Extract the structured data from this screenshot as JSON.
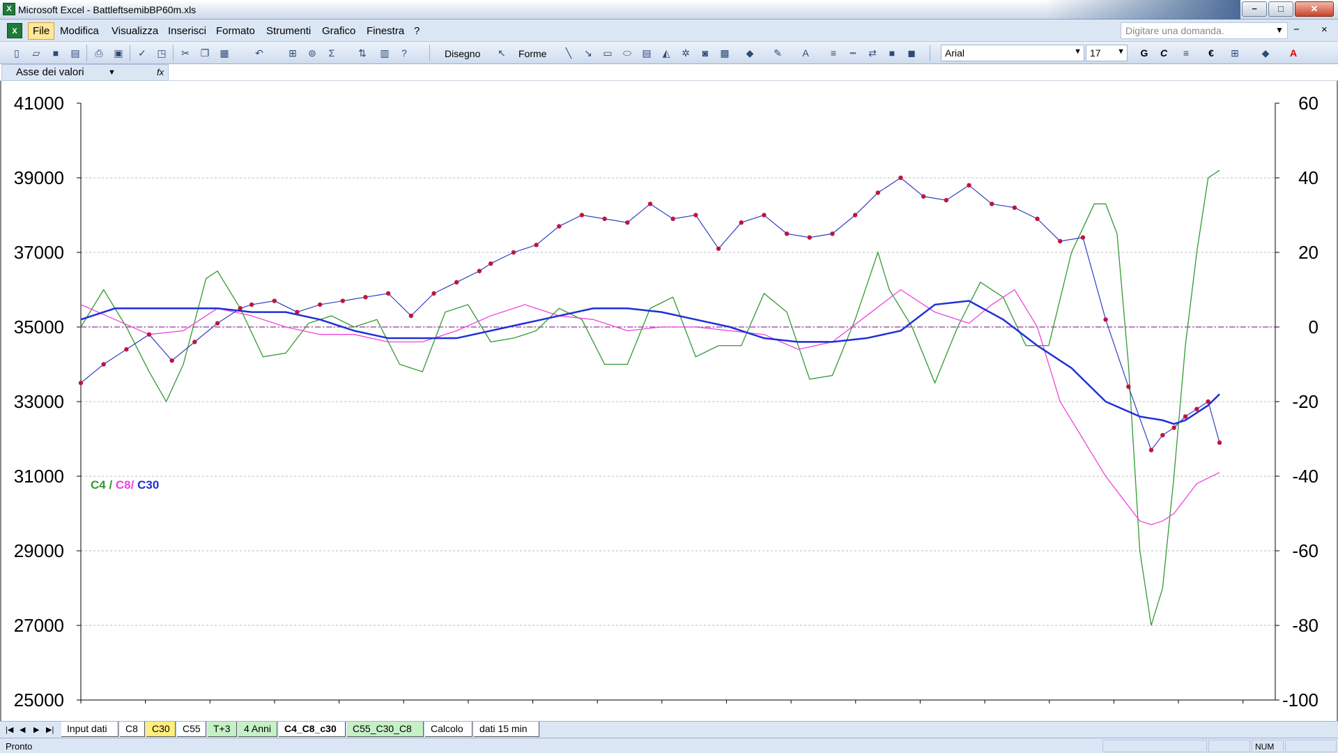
{
  "window": {
    "title": "Microsoft Excel - BattleftsemibBP60m.xls",
    "min_label": "−",
    "max_label": "□",
    "close_label": "✕"
  },
  "menu": {
    "items": [
      "File",
      "Modifica",
      "Visualizza",
      "Inserisci",
      "Formato",
      "Strumenti",
      "Grafico",
      "Finestra",
      "?"
    ],
    "help_placeholder": "Digitare una domanda.",
    "right_icons": [
      "−",
      "×"
    ]
  },
  "toolbar": {
    "draw_label": "Disegno",
    "shapes_label": "Forme",
    "font_name": "Arial",
    "font_size": "17",
    "bold_label": "G",
    "italic_label": "C",
    "euro_label": "€",
    "font_color_label": "A"
  },
  "namebox": {
    "value": "Asse dei valori",
    "fx_label": "fx"
  },
  "colors": {
    "c4": "#339933",
    "c8": "#ee44dd",
    "c30": "#1f2fd8",
    "price_line": "#3040c0",
    "price_marker": "#c0143c",
    "zero_line": "#993399"
  },
  "chart_data": {
    "type": "line",
    "legend_label": {
      "c4": "C4",
      "sep1": " / ",
      "c8": "C8/",
      "sep2": " ",
      "c30": "C30"
    },
    "y_left": {
      "min": 25000,
      "max": 41000,
      "step": 2000,
      "ticks": [
        "41000",
        "39000",
        "37000",
        "35000",
        "33000",
        "31000",
        "29000",
        "27000",
        "25000"
      ]
    },
    "y_right": {
      "min": -100,
      "max": 60,
      "step": 20,
      "ticks": [
        "60",
        "40",
        "20",
        "0",
        "-20",
        "-40",
        "-60",
        "-80",
        "-100"
      ]
    },
    "x_range": [
      0,
      100
    ],
    "grid": true,
    "zero_reference": 0,
    "price": {
      "name": "price",
      "x": [
        0,
        2,
        4,
        6,
        8,
        10,
        12,
        14,
        15,
        17,
        19,
        21,
        23,
        25,
        27,
        29,
        31,
        33,
        35,
        36,
        38,
        40,
        42,
        44,
        46,
        48,
        50,
        52,
        54,
        56,
        58,
        60,
        62,
        64,
        66,
        68,
        70,
        72,
        74,
        76,
        78,
        80,
        82,
        84,
        86,
        88,
        90,
        92,
        94,
        95,
        96,
        97,
        98,
        99,
        100
      ],
      "y": [
        33500,
        34000,
        34400,
        34800,
        34100,
        34600,
        35100,
        35500,
        35600,
        35700,
        35400,
        35600,
        35700,
        35800,
        35900,
        35300,
        35900,
        36200,
        36500,
        36700,
        37000,
        37200,
        37700,
        38000,
        37900,
        37800,
        38300,
        37900,
        38000,
        37100,
        37800,
        38000,
        37500,
        37400,
        37500,
        38000,
        38600,
        39000,
        38500,
        38400,
        38800,
        38300,
        38200,
        37900,
        37300,
        37400,
        35200,
        33400,
        31700,
        32100,
        32300,
        32600,
        32800,
        33000,
        31900
      ]
    },
    "series": [
      {
        "name": "C4",
        "x": [
          0,
          2,
          4,
          6,
          7.5,
          9,
          11,
          12,
          14,
          16,
          18,
          20,
          22,
          24,
          26,
          28,
          30,
          32,
          34,
          36,
          38,
          40,
          42,
          44,
          46,
          48,
          50,
          52,
          54,
          56,
          58,
          60,
          62,
          64,
          66,
          68,
          70,
          71,
          73,
          75,
          77,
          79,
          81,
          83,
          85,
          87,
          89,
          90,
          91,
          92,
          93,
          94,
          95,
          96,
          97,
          98,
          99,
          100
        ],
        "y": [
          0,
          10,
          0,
          -12,
          -20,
          -10,
          13,
          15,
          5,
          -8,
          -7,
          1,
          3,
          0,
          2,
          -10,
          -12,
          4,
          6,
          -4,
          -3,
          -1,
          5,
          2,
          -10,
          -10,
          5,
          8,
          -8,
          -5,
          -5,
          9,
          4,
          -14,
          -13,
          2,
          20,
          10,
          0,
          -15,
          0,
          12,
          8,
          -5,
          -5,
          20,
          33,
          33,
          25,
          -10,
          -60,
          -80,
          -70,
          -40,
          -5,
          20,
          40,
          42
        ]
      },
      {
        "name": "C8",
        "x": [
          0,
          3,
          6,
          9,
          12,
          15,
          18,
          21,
          24,
          27,
          30,
          33,
          36,
          39,
          42,
          45,
          48,
          51,
          54,
          57,
          60,
          63,
          66,
          69,
          72,
          75,
          78,
          80,
          82,
          84,
          86,
          88,
          90,
          92,
          93,
          94,
          95,
          96,
          97,
          98,
          100
        ],
        "y": [
          6,
          2,
          -2,
          -1,
          5,
          3,
          0,
          -2,
          -2,
          -4,
          -4,
          -1,
          3,
          6,
          3,
          2,
          -1,
          0,
          0,
          -1,
          -2,
          -6,
          -4,
          3,
          10,
          4,
          1,
          6,
          10,
          0,
          -20,
          -30,
          -40,
          -48,
          -52,
          -53,
          -52,
          -50,
          -46,
          -42,
          -39
        ]
      },
      {
        "name": "C30",
        "x": [
          0,
          3,
          6,
          9,
          12,
          15,
          18,
          21,
          24,
          27,
          30,
          33,
          36,
          39,
          42,
          45,
          48,
          51,
          54,
          57,
          60,
          63,
          66,
          69,
          72,
          75,
          78,
          81,
          84,
          87,
          90,
          93,
          95,
          96,
          97,
          98,
          99,
          100
        ],
        "y": [
          2,
          5,
          5,
          5,
          5,
          4,
          4,
          2,
          -1,
          -3,
          -3,
          -3,
          -1,
          1,
          3,
          5,
          5,
          4,
          2,
          0,
          -3,
          -4,
          -4,
          -3,
          -1,
          6,
          7,
          2,
          -5,
          -11,
          -20,
          -24,
          -25,
          -26,
          -25,
          -23,
          -21,
          -18
        ]
      }
    ]
  },
  "sheets": {
    "tabs": [
      "Input dati",
      "C8",
      "C30",
      "C55",
      "T+3",
      "4 Anni",
      "C4_C8_c30",
      "C55_C30_C8",
      "Calcolo",
      "dati 15 min"
    ],
    "active": "C4_C8_c30"
  },
  "status": {
    "text": "Pronto",
    "num": "NUM"
  }
}
